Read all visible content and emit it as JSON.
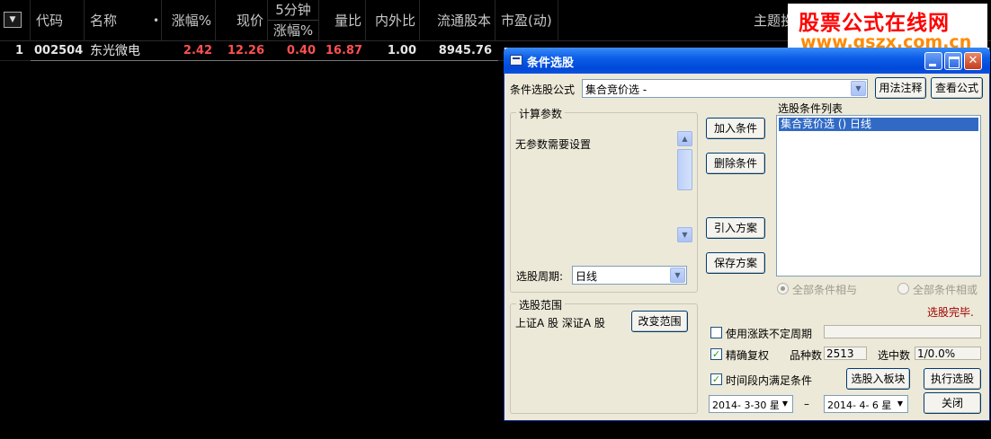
{
  "grid": {
    "headers": {
      "sort_icon": "▼",
      "code": "代码",
      "name": "名称",
      "name_marker": "•",
      "change_pct": "涨幅%",
      "price": "现价",
      "five_min_top": "5分钟",
      "five_min_bottom": "涨幅%",
      "volume_ratio": "量比",
      "in_out_ratio": "内外比",
      "float_shares": "流通股本",
      "pe": "市盈(动)",
      "theme": "主题投"
    },
    "rows": [
      {
        "index": "1",
        "code": "002504",
        "name": "东光微电",
        "change_pct": "2.42",
        "price": "12.26",
        "five_min_change": "0.40",
        "volume_ratio": "16.87",
        "in_out_ratio": "1.00",
        "float_shares": "8945.76"
      }
    ]
  },
  "watermark": {
    "line1": "股票公式在线网",
    "line2": "www.gszx.com.cn"
  },
  "dialog": {
    "title": "条件选股",
    "formula_label": "条件选股公式",
    "formula_value": "集合竞价选 -",
    "usage_button": "用法注释",
    "view_formula_button": "查看公式",
    "params_group_title": "计算参数",
    "params_text": "无参数需要设置",
    "period_label": "选股周期:",
    "period_value": "日线",
    "add_condition_button": "加入条件",
    "delete_condition_button": "删除条件",
    "import_plan_button": "引入方案",
    "save_plan_button": "保存方案",
    "condition_list_label": "选股条件列表",
    "condition_items": [
      "集合竞价选 () 日线"
    ],
    "radio_and": "全部条件相与",
    "radio_or": "全部条件相或",
    "status_text": "选股完毕.",
    "range_group_title": "选股范围",
    "range_text": "上证A 股 深证A 股",
    "change_range_button": "改变范围",
    "variable_period_label": "使用涨跌不定周期",
    "exact_rights_label": "精确复权",
    "variety_count_label": "品种数",
    "variety_count_value": "2513",
    "selected_count_label": "选中数",
    "selected_count_value": "1/0.0%",
    "time_range_label": "时间段内满足条件",
    "select_to_block_button": "选股入板块",
    "execute_button": "执行选股",
    "start_date": "2014- 3-30 星",
    "date_separator": "–",
    "end_date": "2014- 4- 6 星",
    "close_button": "关闭"
  },
  "colors": {
    "rise": "#ff5050",
    "selection": "#316ac5",
    "title_bar": "#0c5ee8",
    "status": "#a00000"
  }
}
